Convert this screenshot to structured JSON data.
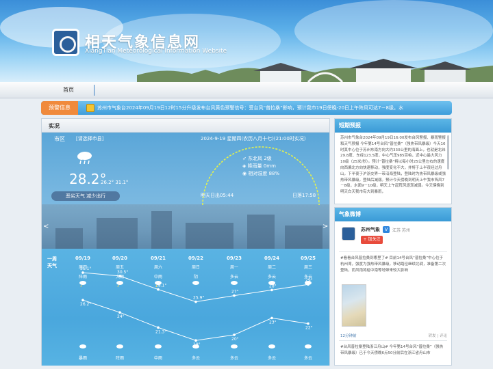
{
  "site": {
    "title": "相天气象信息网",
    "subtitle": "XiangTian Meteorological Information Website"
  },
  "nav": {
    "home": "首页"
  },
  "alert": {
    "tag": "预警信息",
    "text": "苏州市气象台2024年09月19日12时15分升级发布台风黄色预警信号：受台风“普拉桑”影响，预计我市19日傍晚-20日上午阵风可达7－8级。水"
  },
  "live": {
    "title": "实况",
    "city_label": "市区",
    "city_select": "[请选择市县]",
    "date": "2024-9-19 星期四(农历八月十七)(21:00时实况)",
    "temp_now": "28.2°",
    "temp_low": "26.2°",
    "temp_high": "31.1°",
    "aqi": "恶劣天气 减少出行",
    "wind": "东北风  2级",
    "rain": "降雨量  0mm",
    "humidity": "相对湿度  88%",
    "sunrise": "明天日出05:44",
    "sunset": "日落17:58",
    "prev": "<",
    "next": ">"
  },
  "forecast": {
    "label_line1": "一周",
    "label_line2": "天气",
    "days": [
      {
        "date": "09/19",
        "weekday": "周四",
        "day_weather": "阵雨",
        "high": "31.1°",
        "low": "26.2°",
        "night_weather": "暴雨"
      },
      {
        "date": "09/20",
        "weekday": "周五",
        "day_weather": "大雨",
        "high": "30.5°",
        "low": "24°",
        "night_weather": "阵雨"
      },
      {
        "date": "09/21",
        "weekday": "周六",
        "day_weather": "中雨",
        "high": "28.1°",
        "low": "21.3°",
        "night_weather": "中雨"
      },
      {
        "date": "09/22",
        "weekday": "周日",
        "day_weather": "阴",
        "high": "25.9°",
        "low": "19°",
        "night_weather": "多云"
      },
      {
        "date": "09/23",
        "weekday": "周一",
        "day_weather": "多云",
        "high": "27°",
        "low": "20°",
        "night_weather": "多云"
      },
      {
        "date": "09/24",
        "weekday": "周二",
        "day_weather": "多云",
        "high": "28°",
        "low": "23°",
        "night_weather": "多云"
      },
      {
        "date": "09/25",
        "weekday": "周三",
        "day_weather": "多云",
        "high": "29°",
        "low": "22°",
        "night_weather": "多云"
      }
    ]
  },
  "short_forecast": {
    "title": "短期预报",
    "body": "苏州市气象台2024年09月19日16:00发布台风警报、暴雨警报和天气预报 今年第14号台风“普拉桑”（强热带风暴级）今天16时其中心位于苏州东南方向大约330公里的海面上，也就是北纬29.8度、东经123.5度，中心气压985百帕，近中心最大风力10级（25米/秒）。预计“普拉桑”将以每小时25公里左右的速度向西偏北方向快速移动，强度变化不大，并将于上半夜经过舟山，下半夜于沪浙交界一带沿海登陆，登陆时为热带风暴级或强热带风暴级，登陆后减弱。预计今天傍晚到明天上午我市阵风7－8级，水面9－10级，明天上午起阵风逐渐减弱。今天傍晚到明天白天我市有大到暴雨，"
  },
  "weibo": {
    "title": "气象微博",
    "name": "苏州气象",
    "verified": "V",
    "location": "江苏 苏州",
    "follow": "+ 加关注",
    "post1": "#看看台风普拉桑到哪里了# 目前14号台风“普拉桑”中心位于杭州湾，强度为强热带风暴级，移动路径继续北调，准备第二次登陆，而风雨将给中南等地带来较大影响",
    "meta_left": "12分钟前",
    "meta_right": "转发 | 评论",
    "post2": "#台风普拉桑登陆浙江舟山# 今年第14号台风“普拉桑”（强热带风暴级）已于今天傍晚6点50分前后在浙江省舟山市"
  },
  "colors": {
    "alert_tag": "#f08a3c",
    "forecast_bg": "#4aa7dd",
    "follow_button": "#e84b3c"
  }
}
